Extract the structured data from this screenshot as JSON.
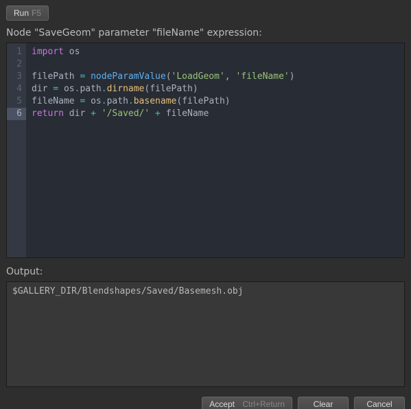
{
  "toolbar": {
    "run": {
      "label": "Run",
      "shortcut": "F5"
    }
  },
  "header": "Node \"SaveGeom\" parameter \"fileName\" expression:",
  "code": {
    "highlight_line": 6,
    "lines": [
      [
        [
          "kw",
          "import"
        ],
        [
          "id",
          " os"
        ]
      ],
      [
        [
          "id",
          ""
        ]
      ],
      [
        [
          "id",
          "filePath "
        ],
        [
          "op",
          "="
        ],
        [
          "id",
          " "
        ],
        [
          "fn",
          "nodeParamValue"
        ],
        [
          "id",
          "("
        ],
        [
          "str",
          "'LoadGeom'"
        ],
        [
          "id",
          ", "
        ],
        [
          "str",
          "'fileName'"
        ],
        [
          "id",
          ")"
        ]
      ],
      [
        [
          "id",
          "dir "
        ],
        [
          "op",
          "="
        ],
        [
          "id",
          " os"
        ],
        [
          "op",
          "."
        ],
        [
          "id",
          "path"
        ],
        [
          "op",
          "."
        ],
        [
          "call",
          "dirname"
        ],
        [
          "id",
          "(filePath)"
        ]
      ],
      [
        [
          "id",
          "fileName "
        ],
        [
          "op",
          "="
        ],
        [
          "id",
          " os"
        ],
        [
          "op",
          "."
        ],
        [
          "id",
          "path"
        ],
        [
          "op",
          "."
        ],
        [
          "call",
          "basename"
        ],
        [
          "id",
          "(filePath)"
        ]
      ],
      [
        [
          "kw",
          "return"
        ],
        [
          "id",
          " dir "
        ],
        [
          "op",
          "+"
        ],
        [
          "id",
          " "
        ],
        [
          "str",
          "'/Saved/'"
        ],
        [
          "id",
          " "
        ],
        [
          "op",
          "+"
        ],
        [
          "id",
          " fileName"
        ]
      ]
    ]
  },
  "output_label": "Output:",
  "output": "$GALLERY_DIR/Blendshapes/Saved/Basemesh.obj",
  "buttons": {
    "accept": {
      "label": "Accept",
      "shortcut": "Ctrl+Return"
    },
    "clear": "Clear",
    "cancel": "Cancel"
  }
}
